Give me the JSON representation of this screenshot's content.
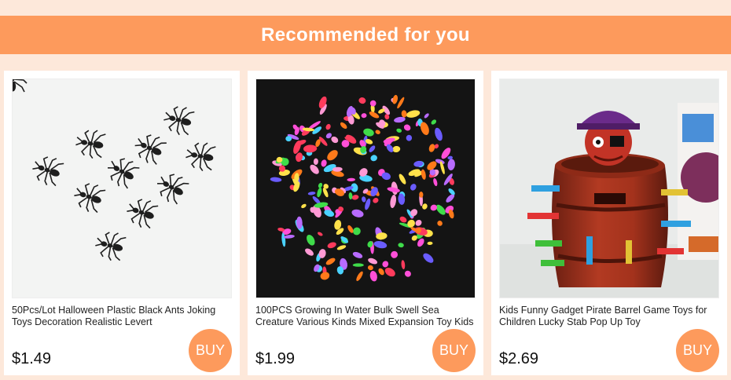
{
  "header": {
    "title": "Recommended for you"
  },
  "products": [
    {
      "title": "50Pcs/Lot Halloween Plastic Black Ants Joking Toys Decoration Realistic Levert",
      "price": "$1.49",
      "buy_label": "BUY",
      "image": "black-plastic-ants-image"
    },
    {
      "title": "100PCS Growing In Water Bulk Swell Sea Creature Various Kinds Mixed Expansion Toy Kids",
      "price": "$1.99",
      "buy_label": "BUY",
      "image": "colorful-sea-creatures-image"
    },
    {
      "title": "Kids Funny Gadget Pirate Barrel Game Toys for Children Lucky Stab Pop Up Toy",
      "price": "$2.69",
      "buy_label": "BUY",
      "image": "pirate-barrel-toy-image"
    }
  ],
  "colors": {
    "background": "#fde8da",
    "accent": "#fd9a5c",
    "card": "#ffffff"
  }
}
